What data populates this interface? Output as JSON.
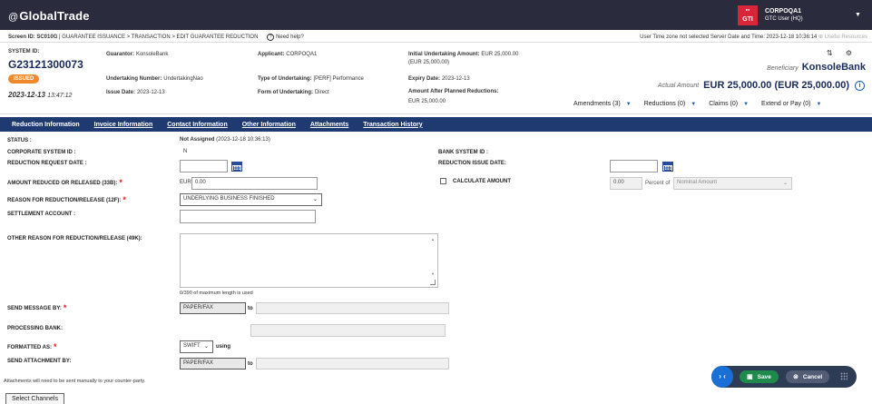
{
  "app": {
    "logo_prefix": "@",
    "logo_text": "GlobalTrade"
  },
  "user": {
    "badge": "GTI",
    "badge_small": "●●",
    "name": "CORPOQA1",
    "role": "GTC User (HQ)"
  },
  "crumb": {
    "screen_id": "Screen ID: SC010G",
    "path": "GUARANTEE ISSUANCE > TRANSACTION > EDIT GUARANTEE REDUCTION",
    "help": "Need help?",
    "timezone": "User Time zone not selected  Server Date and Time: 2023-12-18 10:36:14",
    "useful": "Useful Resources"
  },
  "header": {
    "system_id_label": "SYSTEM ID:",
    "system_id": "G23121300073",
    "status_badge": "ISSUED",
    "date": "2023-12-13",
    "time": "13:47:12",
    "guarantor_label": "Guarantor:",
    "guarantor": "KonsoleBank",
    "undertaking_no_label": "Undertaking Number:",
    "undertaking_no": "UndertakingNao",
    "issue_date_label": "Issue Date:",
    "issue_date": "2023-12-13",
    "applicant_label": "Applicant:",
    "applicant": "CORPOQA1",
    "type_label": "Type of Undertaking:",
    "type": "[PERF] Performance",
    "form_label": "Form of Undertaking:",
    "form": "Direct",
    "initial_amt_label": "Initial Undertaking Amount:",
    "initial_amt": "EUR 25,000.00",
    "initial_amt_sub": "(EUR 25,000.00)",
    "expiry_label": "Expiry Date:",
    "expiry": "2023-12-13",
    "after_label": "Amount After Planned Reductions:",
    "after": "EUR 25,000.00",
    "beneficiary_label": "Beneficiary",
    "beneficiary": "KonsoleBank",
    "actual_label": "Actual Amount",
    "actual": "EUR 25,000.00 (EUR 25,000.00)",
    "top_icons": "⇅ ⚙",
    "dropdowns": [
      "Amendments (3)",
      "Reductions (0)",
      "Claims (0)",
      "Extend or Pay (0)"
    ]
  },
  "tabs": [
    "Reduction Information",
    "Invoice Information",
    "Contact Information",
    "Other Information",
    "Attachments",
    "Transaction History"
  ],
  "form": {
    "status_label": "STATUS :",
    "status_value": "Not Assigned",
    "status_time": "(2023-12-18 10:36:13)",
    "corp_sys_label": "CORPORATE SYSTEM ID :",
    "corp_sys_value": "N",
    "bank_sys_label": "BANK SYSTEM ID :",
    "req_date_label": "REDUCTION REQUEST DATE :",
    "issue_date_label": "REDUCTION ISSUE DATE:",
    "amount_label": "AMOUNT REDUCED OR RELEASED (33B):",
    "currency": "EUR",
    "amount": "0.00",
    "calc_label": "CALCULATE AMOUNT",
    "calc_value": "0.00",
    "percent_of": "Percent of",
    "nominal_placeholder": "Nominal Amount",
    "reason_label": "REASON FOR REDUCTION/RELEASE (12F):",
    "reason_value": "UNDERLYING BUSINESS FINISHED",
    "settlement_label": "SETTLEMENT ACCOUNT :",
    "other_reason_label": "OTHER REASON FOR REDUCTION/RELEASE (49K):",
    "maxlen": "0/390 of maximum length is used",
    "send_msg_label": "SEND MESSAGE BY:",
    "send_msg_value": "PAPER/FAX",
    "to": "to",
    "proc_bank_label": "PROCESSING BANK:",
    "formatted_label": "FORMATTED AS:",
    "formatted_value": "SWIFT",
    "using": "using",
    "send_att_label": "SEND ATTACHMENT BY:",
    "send_att_value": "PAPER/FAX",
    "att_note": "Attachments will need to be sent manually to your counter-party.",
    "select_channels": "Select Channels"
  },
  "actions": {
    "toggle": "› ‹",
    "save": "Save",
    "cancel": "Cancel"
  }
}
